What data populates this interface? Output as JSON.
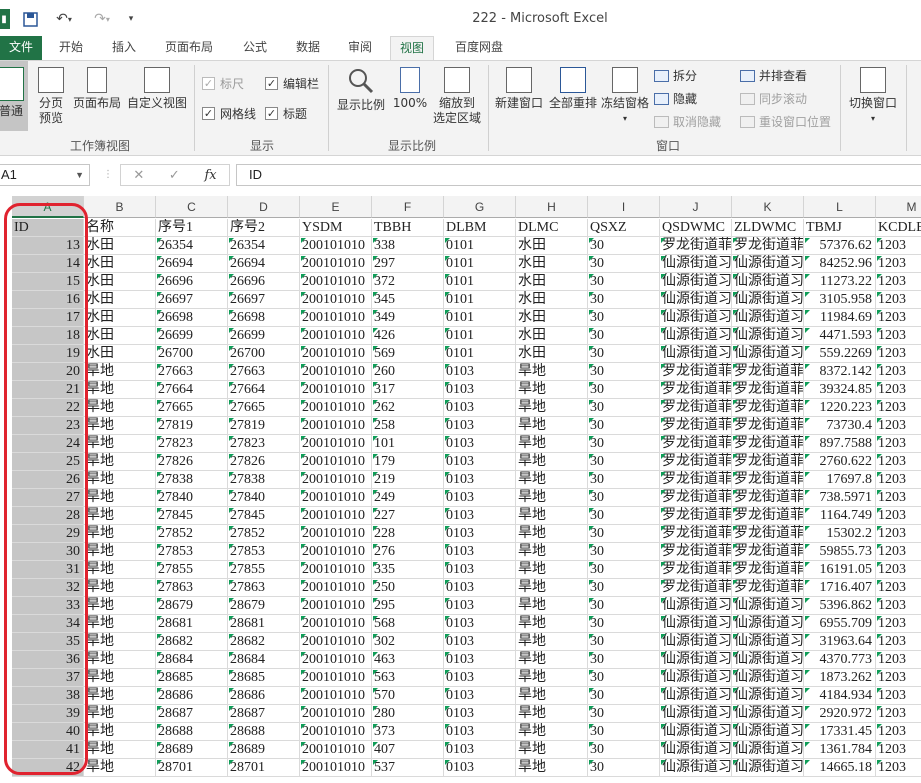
{
  "window": {
    "title": "222 - Microsoft Excel"
  },
  "tabs": [
    "文件",
    "开始",
    "插入",
    "页面布局",
    "公式",
    "数据",
    "审阅",
    "视图",
    "百度网盘"
  ],
  "active_tab": "视图",
  "ribbon": {
    "workbook_views": {
      "label": "工作簿视图",
      "normal": "普通",
      "page_break": "分页\n预览",
      "page_layout": "页面布局",
      "custom_views": "自定义视图"
    },
    "show": {
      "label": "显示",
      "ruler": "标尺",
      "formula_bar": "编辑栏",
      "gridlines": "网格线",
      "headings": "标题"
    },
    "zoom": {
      "label": "显示比例",
      "zoom": "显示比例",
      "zoom_100": "100%",
      "zoom_selection": "缩放到\n选定区域"
    },
    "window": {
      "label": "窗口",
      "new_window": "新建窗口",
      "arrange_all": "全部重排",
      "freeze_panes": "冻结窗格",
      "split": "拆分",
      "hide": "隐藏",
      "unhide": "取消隐藏",
      "side_by_side": "并排查看",
      "sync_scroll": "同步滚动",
      "reset_position": "重设窗口位置",
      "switch_windows": "切换窗口"
    }
  },
  "formula_bar": {
    "name_box": "A1",
    "content": "ID"
  },
  "columns": [
    "A",
    "B",
    "C",
    "D",
    "E",
    "F",
    "G",
    "H",
    "I",
    "J",
    "K",
    "L",
    "M"
  ],
  "header_row": [
    "ID",
    "名称",
    "序号1",
    "序号2",
    "YSDM",
    "TBBH",
    "DLBM",
    "DLMC",
    "QSXZ",
    "QSDWMC",
    "ZLDWMC",
    "TBMJ",
    "KCDLBM"
  ],
  "rows": [
    [
      "13",
      "水田",
      "26354",
      "26354",
      "200101010",
      "338",
      "0101",
      "水田",
      "30",
      "罗龙街道菲",
      "罗龙街道菲",
      "57376.62",
      "1203"
    ],
    [
      "14",
      "水田",
      "26694",
      "26694",
      "200101010",
      "297",
      "0101",
      "水田",
      "30",
      "仙源街道习",
      "仙源街道习",
      "84252.96",
      "1203"
    ],
    [
      "15",
      "水田",
      "26696",
      "26696",
      "200101010",
      "372",
      "0101",
      "水田",
      "30",
      "仙源街道习",
      "仙源街道习",
      "11273.22",
      "1203"
    ],
    [
      "16",
      "水田",
      "26697",
      "26697",
      "200101010",
      "345",
      "0101",
      "水田",
      "30",
      "仙源街道习",
      "仙源街道习",
      "3105.958",
      "1203"
    ],
    [
      "17",
      "水田",
      "26698",
      "26698",
      "200101010",
      "349",
      "0101",
      "水田",
      "30",
      "仙源街道习",
      "仙源街道习",
      "11984.69",
      "1203"
    ],
    [
      "18",
      "水田",
      "26699",
      "26699",
      "200101010",
      "426",
      "0101",
      "水田",
      "30",
      "仙源街道习",
      "仙源街道习",
      "4471.593",
      "1203"
    ],
    [
      "19",
      "水田",
      "26700",
      "26700",
      "200101010",
      "569",
      "0101",
      "水田",
      "30",
      "仙源街道习",
      "仙源街道习",
      "559.2269",
      "1203"
    ],
    [
      "20",
      "旱地",
      "27663",
      "27663",
      "200101010",
      "260",
      "0103",
      "旱地",
      "30",
      "罗龙街道菲",
      "罗龙街道菲",
      "8372.142",
      "1203"
    ],
    [
      "21",
      "旱地",
      "27664",
      "27664",
      "200101010",
      "317",
      "0103",
      "旱地",
      "30",
      "罗龙街道菲",
      "罗龙街道菲",
      "39324.85",
      "1203"
    ],
    [
      "22",
      "旱地",
      "27665",
      "27665",
      "200101010",
      "262",
      "0103",
      "旱地",
      "30",
      "罗龙街道菲",
      "罗龙街道菲",
      "1220.223",
      "1203"
    ],
    [
      "23",
      "旱地",
      "27819",
      "27819",
      "200101010",
      "258",
      "0103",
      "旱地",
      "30",
      "罗龙街道菲",
      "罗龙街道菲",
      "73730.4",
      "1203"
    ],
    [
      "24",
      "旱地",
      "27823",
      "27823",
      "200101010",
      "101",
      "0103",
      "旱地",
      "30",
      "罗龙街道菲",
      "罗龙街道菲",
      "897.7588",
      "1203"
    ],
    [
      "25",
      "旱地",
      "27826",
      "27826",
      "200101010",
      "179",
      "0103",
      "旱地",
      "30",
      "罗龙街道菲",
      "罗龙街道菲",
      "2760.622",
      "1203"
    ],
    [
      "26",
      "旱地",
      "27838",
      "27838",
      "200101010",
      "219",
      "0103",
      "旱地",
      "30",
      "罗龙街道菲",
      "罗龙街道菲",
      "17697.8",
      "1203"
    ],
    [
      "27",
      "旱地",
      "27840",
      "27840",
      "200101010",
      "249",
      "0103",
      "旱地",
      "30",
      "罗龙街道菲",
      "罗龙街道菲",
      "738.5971",
      "1203"
    ],
    [
      "28",
      "旱地",
      "27845",
      "27845",
      "200101010",
      "227",
      "0103",
      "旱地",
      "30",
      "罗龙街道菲",
      "罗龙街道菲",
      "1164.749",
      "1203"
    ],
    [
      "29",
      "旱地",
      "27852",
      "27852",
      "200101010",
      "228",
      "0103",
      "旱地",
      "30",
      "罗龙街道菲",
      "罗龙街道菲",
      "15302.2",
      "1203"
    ],
    [
      "30",
      "旱地",
      "27853",
      "27853",
      "200101010",
      "276",
      "0103",
      "旱地",
      "30",
      "罗龙街道菲",
      "罗龙街道菲",
      "59855.73",
      "1203"
    ],
    [
      "31",
      "旱地",
      "27855",
      "27855",
      "200101010",
      "335",
      "0103",
      "旱地",
      "30",
      "罗龙街道菲",
      "罗龙街道菲",
      "16191.05",
      "1203"
    ],
    [
      "32",
      "旱地",
      "27863",
      "27863",
      "200101010",
      "250",
      "0103",
      "旱地",
      "30",
      "罗龙街道菲",
      "罗龙街道菲",
      "1716.407",
      "1203"
    ],
    [
      "33",
      "旱地",
      "28679",
      "28679",
      "200101010",
      "295",
      "0103",
      "旱地",
      "30",
      "仙源街道习",
      "仙源街道习",
      "5396.862",
      "1203"
    ],
    [
      "34",
      "旱地",
      "28681",
      "28681",
      "200101010",
      "568",
      "0103",
      "旱地",
      "30",
      "仙源街道习",
      "仙源街道习",
      "6955.709",
      "1203"
    ],
    [
      "35",
      "旱地",
      "28682",
      "28682",
      "200101010",
      "302",
      "0103",
      "旱地",
      "30",
      "仙源街道习",
      "仙源街道习",
      "31963.64",
      "1203"
    ],
    [
      "36",
      "旱地",
      "28684",
      "28684",
      "200101010",
      "463",
      "0103",
      "旱地",
      "30",
      "仙源街道习",
      "仙源街道习",
      "4370.773",
      "1203"
    ],
    [
      "37",
      "旱地",
      "28685",
      "28685",
      "200101010",
      "563",
      "0103",
      "旱地",
      "30",
      "仙源街道习",
      "仙源街道习",
      "1873.262",
      "1203"
    ],
    [
      "38",
      "旱地",
      "28686",
      "28686",
      "200101010",
      "570",
      "0103",
      "旱地",
      "30",
      "仙源街道习",
      "仙源街道习",
      "4184.934",
      "1203"
    ],
    [
      "39",
      "旱地",
      "28687",
      "28687",
      "200101010",
      "280",
      "0103",
      "旱地",
      "30",
      "仙源街道习",
      "仙源街道习",
      "2920.972",
      "1203"
    ],
    [
      "40",
      "旱地",
      "28688",
      "28688",
      "200101010",
      "373",
      "0103",
      "旱地",
      "30",
      "仙源街道习",
      "仙源街道习",
      "17331.45",
      "1203"
    ],
    [
      "41",
      "旱地",
      "28689",
      "28689",
      "200101010",
      "407",
      "0103",
      "旱地",
      "30",
      "仙源街道习",
      "仙源街道习",
      "1361.784",
      "1203"
    ],
    [
      "42",
      "旱地",
      "28701",
      "28701",
      "200101010",
      "537",
      "0103",
      "旱地",
      "30",
      "仙源街道习",
      "仙源街道习",
      "14665.18",
      "1203"
    ]
  ],
  "colors": {
    "accent": "#217346",
    "highlight": "#e0232f",
    "selection": "#c6c6c6"
  }
}
